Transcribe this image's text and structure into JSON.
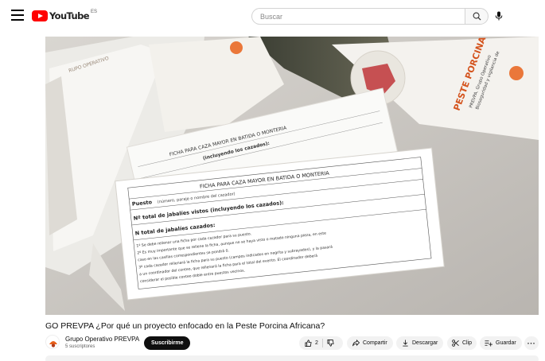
{
  "header": {
    "logo_text": "YouTube",
    "region_code": "ES",
    "search_placeholder": "Buscar"
  },
  "video": {
    "thumbnail_texts": {
      "form_title": "FICHA PARA CAZA MAYOR EN BATIDA O MONTERIA",
      "field_puesto": "Puesto",
      "field_puesto_hint": "(número, paraje o nombre del cazador)",
      "field_vistos": "Nº total de jabalíes vistos (incluyendo los cazados):",
      "field_cazados": "N total de jabalíes cazados:",
      "note_1": "1º Se debe rellenar una ficha por cada cazador para su puesto.",
      "note_2": "2º Es muy importante que se rellene la ficha, aunque no se haya visto o matado ninguna pieza, en este",
      "note_3": "caso en las casillas correspondientes se pondrá 0.",
      "note_4": "3º cada cazador rellenará la ficha para su puesto (campos indicados en negrita y subrayados), y la pasará",
      "note_5": "a un coordinador del conteo, que rellenará la ficha para el total del evento. El coordinador deberá",
      "note_6": "considerar el posible conteo doble entre puestos vecinos.",
      "back_form_title": "FICHA PARA CAZA MAYOR EN BATIDA O MONTERIA",
      "back_form_line": "(incluyendo los cazados):",
      "brochure_title": "PESTE PORCINA A",
      "brochure_sub": "PREVPA. Grupo Operativo",
      "brochure_sub2": "Bioseguridad y vigilancia de"
    }
  },
  "title": "GO PREVPA ¿Por qué un proyecto enfocado en la Peste Porcina Africana?",
  "channel": {
    "name": "Grupo Operativo PREVPA",
    "subscribers": "5 suscriptores",
    "subscribe_label": "Suscribirme"
  },
  "actions": {
    "like_count": "2",
    "share_label": "Compartir",
    "download_label": "Descargar",
    "clip_label": "Clip",
    "save_label": "Guardar",
    "more_label": "···"
  },
  "colors": {
    "brand_red": "#ff0000",
    "subscribe_bg": "#0f0f0f",
    "pill_bg": "#f2f2f2",
    "logo_orange": "#e8611a"
  }
}
